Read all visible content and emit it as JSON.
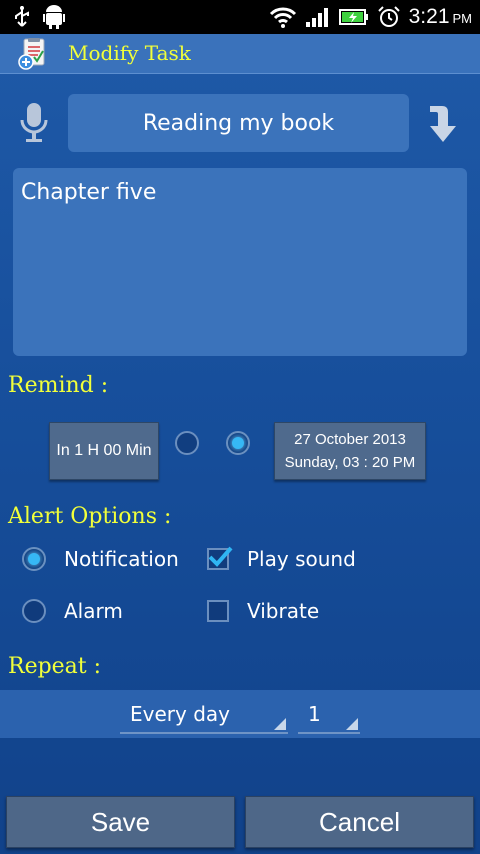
{
  "status_bar": {
    "time": "3:21",
    "ampm": "PM",
    "icons": [
      "usb-icon",
      "android-debug-icon",
      "wifi-icon",
      "signal-icon",
      "battery-charging-icon",
      "alarm-clock-icon"
    ]
  },
  "app": {
    "title": "Modify Task"
  },
  "task": {
    "title": "Reading my book",
    "note": "Chapter five"
  },
  "remind": {
    "label": "Remind :",
    "relative_button": "In 1 H 00 Min",
    "date_line1": "27  October  2013",
    "date_line2": "Sunday, 03 : 20 PM",
    "selected": "date"
  },
  "alert": {
    "label": "Alert Options :",
    "notification": {
      "label": "Notification",
      "selected": true
    },
    "alarm": {
      "label": "Alarm",
      "selected": false
    },
    "play_sound": {
      "label": "Play sound",
      "checked": true
    },
    "vibrate": {
      "label": "Vibrate",
      "checked": false
    }
  },
  "repeat": {
    "label": "Repeat :",
    "frequency": "Every day",
    "interval": "1"
  },
  "actions": {
    "save": "Save",
    "cancel": "Cancel"
  },
  "colors": {
    "accent_yellow": "#f1ff3a",
    "radio_on": "#36b8f5",
    "check": "#2fb6f3"
  }
}
